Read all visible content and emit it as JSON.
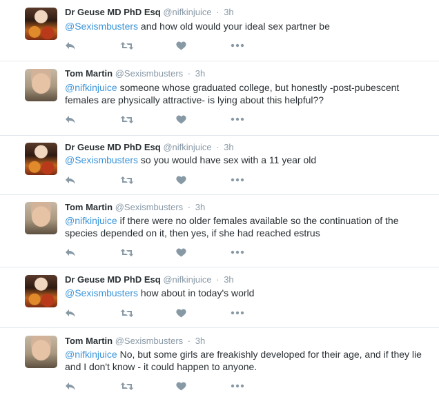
{
  "tweets": [
    {
      "name": "Dr Geuse MD PhD Esq",
      "handle": "@nifkinjuice",
      "separator": "·",
      "time": "3h",
      "mention": "@Sexismbusters",
      "text": " and how old would your ideal sex partner be",
      "avatar": "avatar-a"
    },
    {
      "name": "Tom Martin",
      "handle": "@Sexismbusters",
      "separator": "·",
      "time": "3h",
      "mention": "@nifkinjuice",
      "text": " someone whose graduated college, but honestly -post-pubescent females are physically attractive- is lying about this helpful??",
      "avatar": "avatar-b"
    },
    {
      "name": "Dr Geuse MD PhD Esq",
      "handle": "@nifkinjuice",
      "separator": "·",
      "time": "3h",
      "mention": "@Sexismbusters",
      "text": " so you would have sex with a 11 year old",
      "avatar": "avatar-a"
    },
    {
      "name": "Tom Martin",
      "handle": "@Sexismbusters",
      "separator": "·",
      "time": "3h",
      "mention": "@nifkinjuice",
      "text": " if there were no older females available so the continuation of the species depended on it, then yes, if she had reached estrus",
      "avatar": "avatar-b"
    },
    {
      "name": "Dr Geuse MD PhD Esq",
      "handle": "@nifkinjuice",
      "separator": "·",
      "time": "3h",
      "mention": "@Sexismbusters",
      "text": " how about in today's world",
      "avatar": "avatar-a"
    },
    {
      "name": "Tom Martin",
      "handle": "@Sexismbusters",
      "separator": "·",
      "time": "3h",
      "mention": "@nifkinjuice",
      "text": " No, but some girls are freakishly developed for their age, and if they lie and I don't know - it could happen to anyone.",
      "avatar": "avatar-b"
    }
  ],
  "actions": [
    "reply-icon",
    "retweet-icon",
    "like-icon",
    "more-icon"
  ],
  "colors": {
    "mention": "#3b94d9",
    "meta": "#8899a6",
    "icon": "#8899a6",
    "divider": "#e1e8ed"
  }
}
